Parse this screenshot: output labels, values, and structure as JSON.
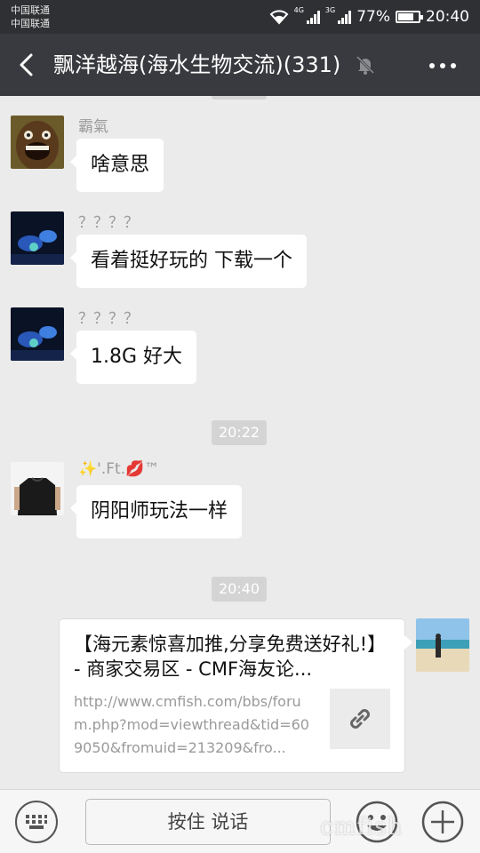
{
  "status_bar": {
    "carrier1": "中国联通",
    "carrier2": "中国联通",
    "net1": "4G",
    "net2": "3G",
    "battery": "77%",
    "battery_level": 0.77,
    "time": "20:40"
  },
  "header": {
    "title": "飘洋越海(海水生物交流)(331)",
    "back_icon": "back-arrow-icon",
    "mute_icon": "mute-bell-icon",
    "more_icon": "more-dots-icon"
  },
  "messages": [
    {
      "sender": "霸氣",
      "text": "啥意思"
    },
    {
      "sender": "？？？？",
      "text": "看着挺好玩的 下载一个"
    },
    {
      "sender": "？？？？",
      "text": "1.8G 好大"
    },
    {
      "sender": "✨'.Ft.💋™",
      "text": "阴阳师玩法一样"
    }
  ],
  "timestamps": [
    "20:22",
    "20:40"
  ],
  "link_card": {
    "title": "【海元素惊喜加推,分享免费送好礼!】 - 商家交易区 - CMF海友论...",
    "url": "http://www.cmfish.com/bbs/forum.php?mod=viewthread&tid=609050&fromuid=213209&fro...",
    "thumb_icon": "link-icon"
  },
  "input_bar": {
    "keyboard_icon": "keyboard-icon",
    "voice_label": "按住 说话",
    "emoji_icon": "emoji-icon",
    "plus_icon": "plus-icon"
  },
  "watermark": "cmfish",
  "colors": {
    "titlebar": "#393a3f",
    "statusbar": "#2f3033",
    "chat_bg": "#ebebeb",
    "bubble": "#ffffff",
    "timestamp_bg": "#d4d4d4"
  }
}
